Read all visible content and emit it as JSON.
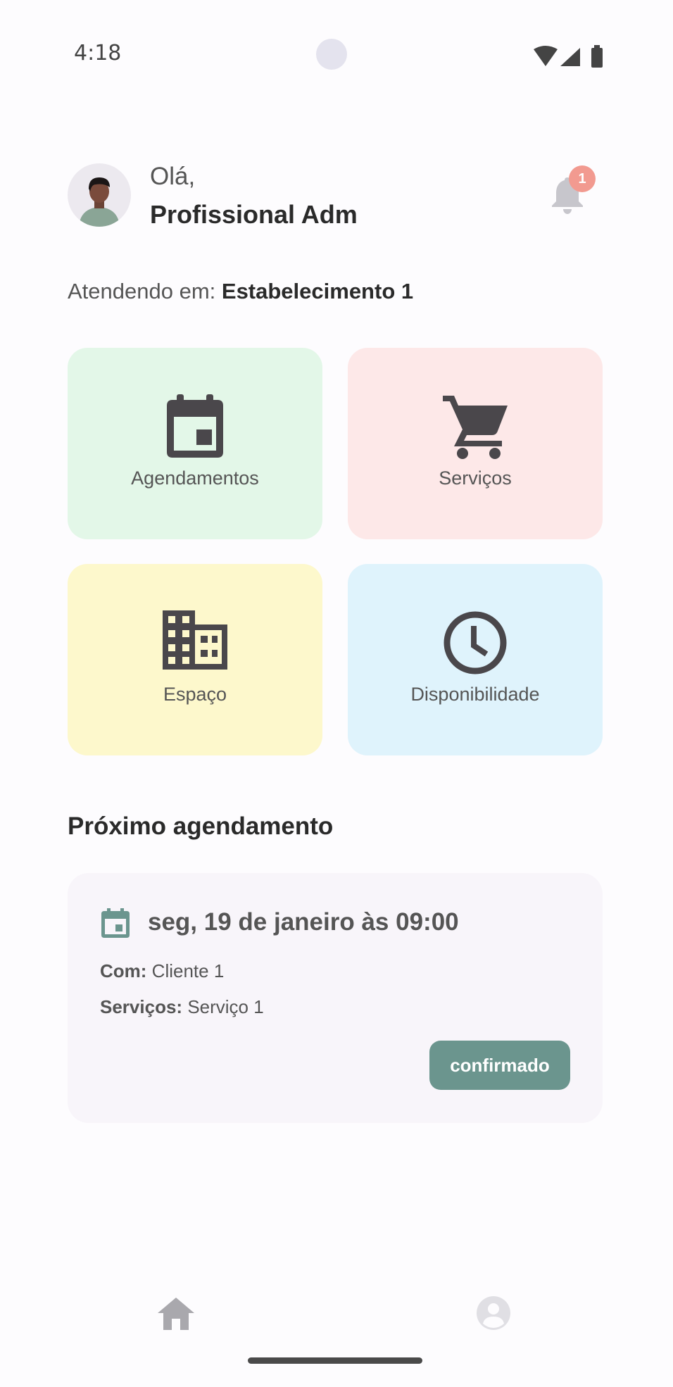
{
  "status_bar": {
    "time": "4:18",
    "icons": [
      "wifi-icon",
      "signal-icon",
      "battery-icon"
    ]
  },
  "header": {
    "greeting": "Olá,",
    "user_name": "Profissional Adm",
    "notifications_count": "1"
  },
  "location": {
    "label": "Atendendo em:",
    "value": "Estabelecimento 1"
  },
  "tiles": [
    {
      "label": "Agendamentos",
      "icon": "calendar-icon",
      "color": "#e3f7e8"
    },
    {
      "label": "Serviços",
      "icon": "cart-icon",
      "color": "#fde8e8"
    },
    {
      "label": "Espaço",
      "icon": "building-icon",
      "color": "#fdf8cc"
    },
    {
      "label": "Disponibilidade",
      "icon": "clock-icon",
      "color": "#dff3fc"
    }
  ],
  "next_appointment": {
    "section_title": "Próximo agendamento",
    "date": "seg, 19 de janeiro às 09:00",
    "with_label": "Com:",
    "with_value": "Cliente 1",
    "services_label": "Serviços:",
    "services_value": "Serviço 1",
    "status": "confirmado",
    "status_color": "#6b958e"
  },
  "bottom_nav": {
    "items": [
      "home-icon",
      "profile-icon"
    ]
  },
  "colors": {
    "icon_dark": "#4a474b",
    "badge": "#f29a90"
  }
}
